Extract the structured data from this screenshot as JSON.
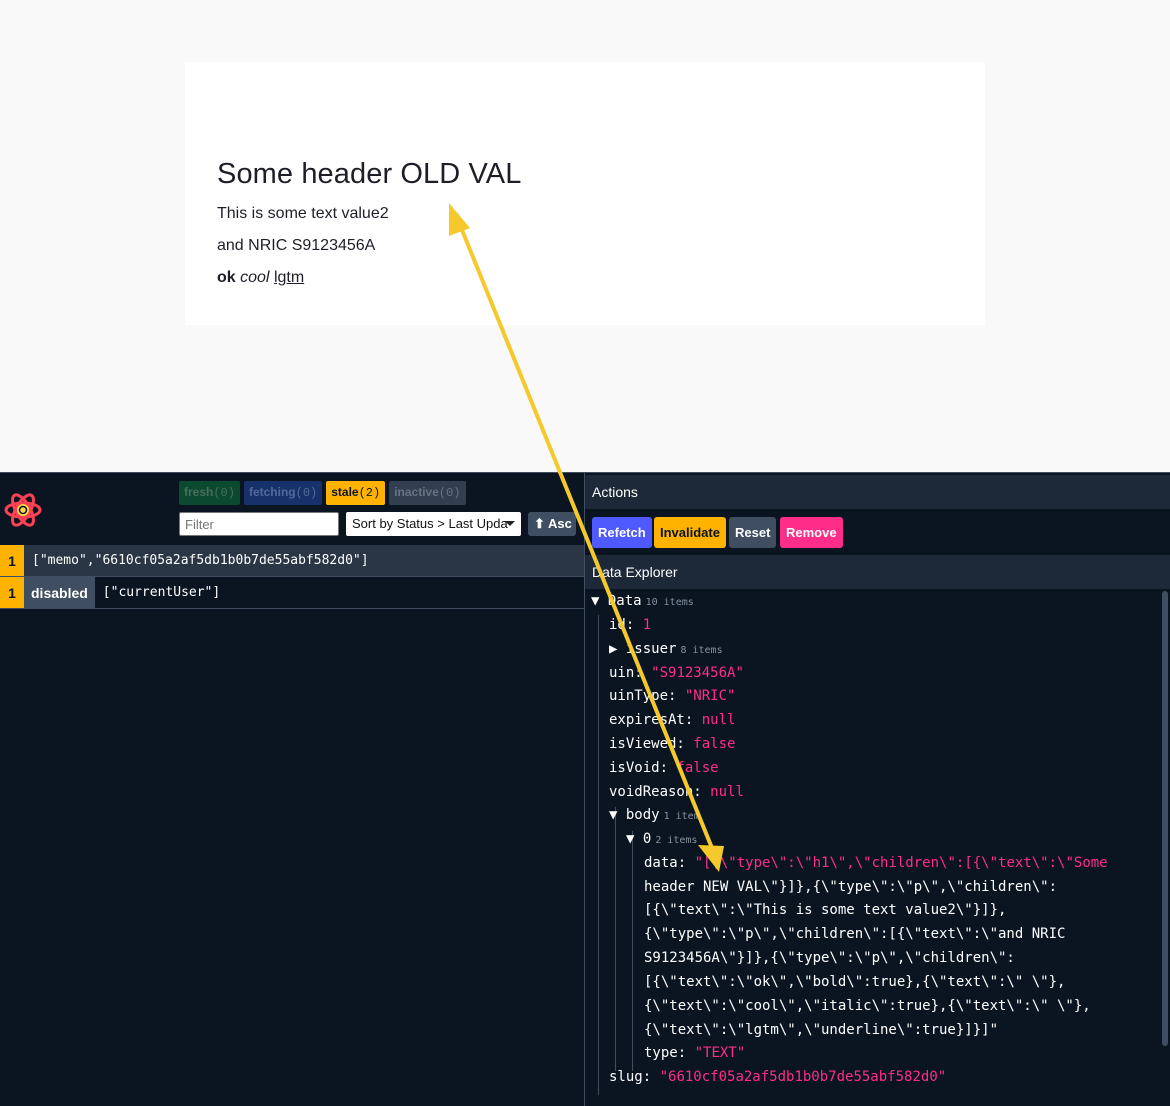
{
  "page": {
    "heading": "Some header OLD VAL",
    "para1": "This is some text value2",
    "para2": "and NRIC S9123456A",
    "bold": "ok",
    "italic": "cool",
    "underline": "lgtm"
  },
  "devtools": {
    "badges": [
      {
        "label": "fresh",
        "count": "(0)"
      },
      {
        "label": "fetching",
        "count": "(0)"
      },
      {
        "label": "stale",
        "count": "(2)"
      },
      {
        "label": "inactive",
        "count": "(0)"
      }
    ],
    "filter_placeholder": "Filter",
    "sort_label": "Sort by Status > Last Upda",
    "asc_label": "⬆ Asc",
    "queries": [
      {
        "count": "1",
        "tag": "",
        "key": "[\"memo\",\"6610cf05a2af5db1b0b7de55abf582d0\"]"
      },
      {
        "count": "1",
        "tag": "disabled",
        "key": "[\"currentUser\"]"
      }
    ],
    "actions_title": "Actions",
    "actions": {
      "refetch": "Refetch",
      "invalidate": "Invalidate",
      "reset": "Reset",
      "remove": "Remove"
    },
    "explorer_title": "Data Explorer",
    "explorer": {
      "root_label": "Data",
      "root_count": "10 items",
      "id_key": "id:",
      "id_val": "1",
      "issuer_key": "issuer",
      "issuer_count": "8 items",
      "uin_key": "uin:",
      "uin_val": "\"S9123456A\"",
      "uintype_key": "uinType:",
      "uintype_val": "\"NRIC\"",
      "expires_key": "expiresAt:",
      "expires_val": "null",
      "isviewed_key": "isViewed:",
      "isviewed_val": "false",
      "isvoid_key": "isVoid:",
      "isvoid_val": "false",
      "voidreason_key": "voidReason:",
      "voidreason_val": "null",
      "body_key": "body",
      "body_count": "1 item",
      "zero_key": "0",
      "zero_count": "2 items",
      "data_key": "data:",
      "data_lines": [
        "\"[{\\\"type\\\":\\\"h1\\\",\\\"children\\\":[{\\\"text\\\":\\\"Some",
        "header NEW VAL\\\"}]},{\\\"type\\\":\\\"p\\\",\\\"children\\\":",
        "[{\\\"text\\\":\\\"This is some text value2\\\"}]},",
        "{\\\"type\\\":\\\"p\\\",\\\"children\\\":[{\\\"text\\\":\\\"and NRIC",
        "S9123456A\\\"}]},{\\\"type\\\":\\\"p\\\",\\\"children\\\":",
        "[{\\\"text\\\":\\\"ok\\\",\\\"bold\\\":true},{\\\"text\\\":\\\" \\\"},",
        "{\\\"text\\\":\\\"cool\\\",\\\"italic\\\":true},{\\\"text\\\":\\\" \\\"},",
        "{\\\"text\\\":\\\"lgtm\\\",\\\"underline\\\":true}]}]\""
      ],
      "type_key": "type:",
      "type_val": "\"TEXT\"",
      "slug_key": "slug:",
      "slug_val": "\"6610cf05a2af5db1b0b7de55abf582d0\""
    }
  },
  "colors": {
    "accent_yellow": "#ffb200",
    "string_pink": "#ff2d8a",
    "refetch_blue": "#4e59ff",
    "arrow": "#f5c92c"
  }
}
